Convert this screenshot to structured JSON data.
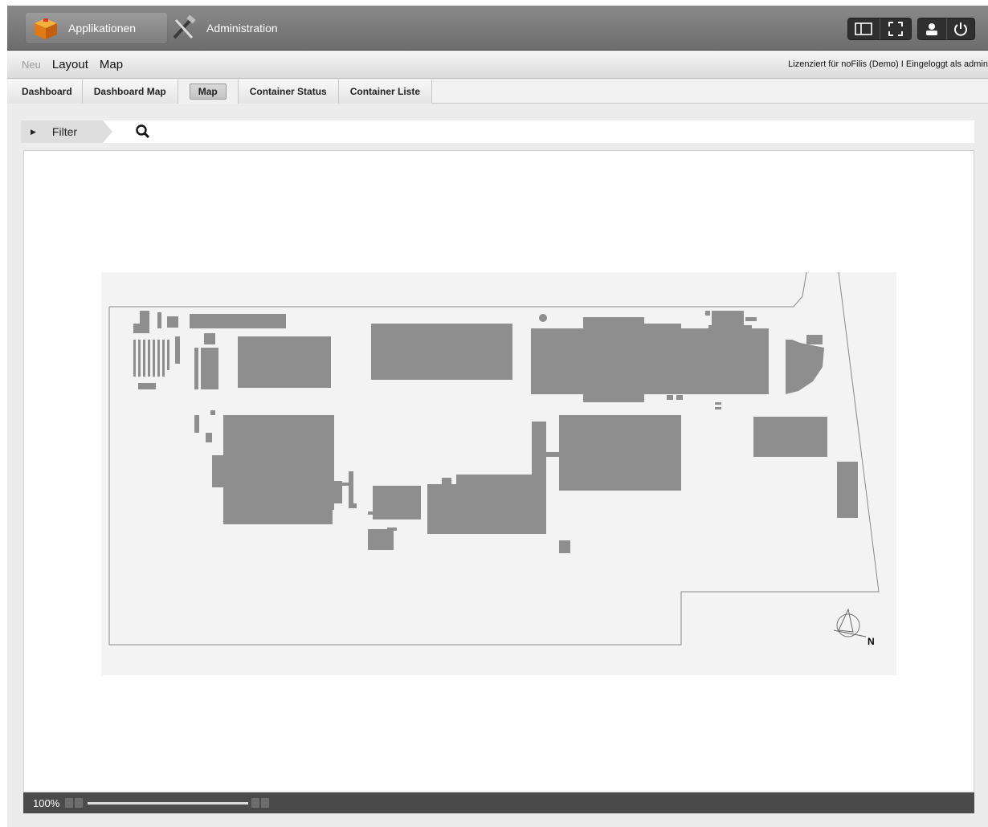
{
  "header": {
    "apps": [
      {
        "label": "Applikationen",
        "icon": "package-icon",
        "active": true
      },
      {
        "label": "Administration",
        "icon": "tools-icon",
        "active": false
      }
    ],
    "toolbar_icons": [
      "split-view-icon",
      "fullscreen-icon",
      "user-icon",
      "power-icon"
    ]
  },
  "menubar": {
    "items": [
      {
        "label": "Neu",
        "disabled": true
      },
      {
        "label": "Layout",
        "disabled": false
      },
      {
        "label": "Map",
        "disabled": false
      }
    ],
    "license_text": "Lizenziert für noFilis (Demo) I Eingeloggt als admin"
  },
  "tabs": [
    {
      "label": "Dashboard",
      "active": false
    },
    {
      "label": "Dashboard Map",
      "active": false
    },
    {
      "label": "Map",
      "active": true
    },
    {
      "label": "Container Status",
      "active": false
    },
    {
      "label": "Container Liste",
      "active": false
    }
  ],
  "filter": {
    "label": "Filter",
    "search_value": "",
    "search_placeholder": ""
  },
  "map": {
    "compass_label": "N",
    "zoom_label": "100%"
  },
  "colors": {
    "building": "#8e8e8f",
    "map_background": "#f3f3f3",
    "header": "#7b7b7b"
  }
}
